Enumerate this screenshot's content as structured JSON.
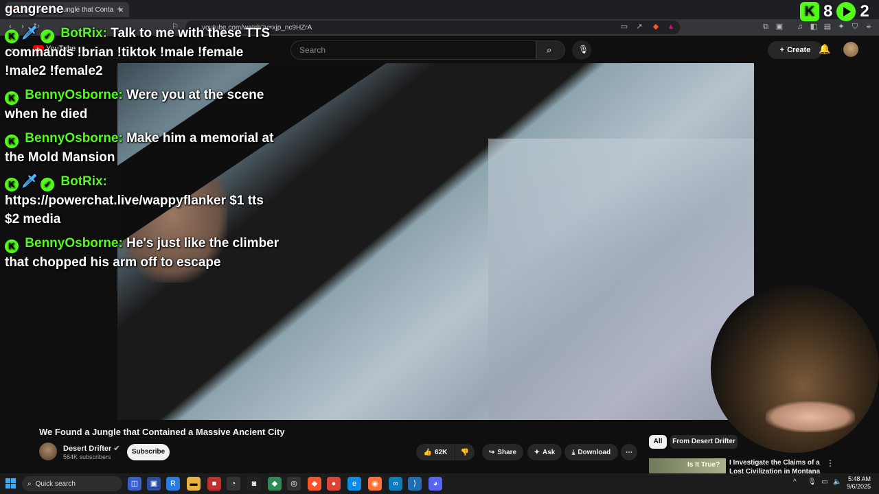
{
  "browser": {
    "tab_title": "We Found a Jungle that Conta",
    "url": "youtube.com/watch?v=xjp_nc9HZrA"
  },
  "youtube": {
    "logo": "YouTube",
    "search_placeholder": "Search",
    "create_label": "Create"
  },
  "stream_overlay": {
    "viewers": "8",
    "followers": "2",
    "chat": [
      {
        "user": "",
        "text": "gangrene"
      },
      {
        "user": "BotRix:",
        "text": "Talk to me with these TTS commands !brian !tiktok !male !female !male2 !female2"
      },
      {
        "user": "BennyOsborne:",
        "text": "Were you at the scene when he died"
      },
      {
        "user": "BennyOsborne:",
        "text": "Make him a memorial at the Mold Mansion"
      },
      {
        "user": "BotRix:",
        "text": "https://powerchat.live/wappyflanker $1 tts $2 media"
      },
      {
        "user": "BennyOsborne:",
        "text": "He's just like the climber that chopped his arm off to escape"
      }
    ]
  },
  "video": {
    "title": "We Found a Jungle that Contained a Massive Ancient City",
    "channel": "Desert Drifter",
    "subscribers": "564K subscribers",
    "subscribe_label": "Subscribe",
    "likes": "62K",
    "share_label": "Share",
    "ask_label": "Ask",
    "download_label": "Download"
  },
  "sidebar": {
    "chip_all": "All",
    "chip_from": "From Desert Drifter",
    "thumb_text": "Is It True?",
    "rec_title": "I Investigate the Claims of a Lost Civilization in Montana"
  },
  "taskbar": {
    "search_label": "Quick search",
    "time": "5:48 AM",
    "date": "9/6/2025"
  }
}
